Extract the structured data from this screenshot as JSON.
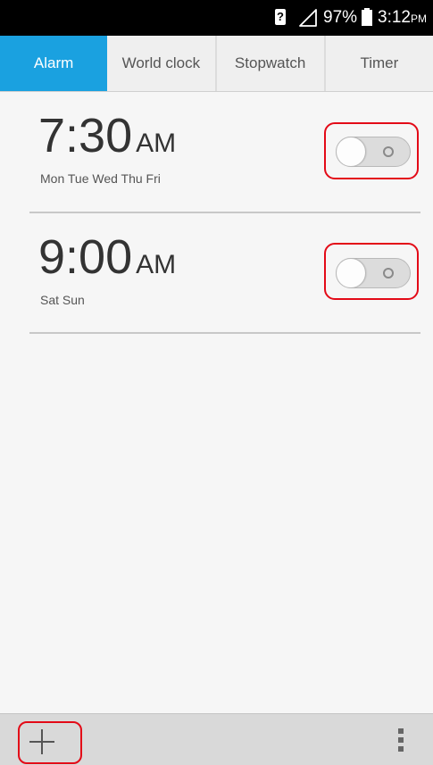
{
  "status_bar": {
    "sim_label": "?",
    "battery_percent": "97%",
    "time": "3:12",
    "time_suffix": "PM"
  },
  "tabs": [
    {
      "label": "Alarm",
      "active": true
    },
    {
      "label": "World clock",
      "active": false
    },
    {
      "label": "Stopwatch",
      "active": false
    },
    {
      "label": "Timer",
      "active": false
    }
  ],
  "alarms": [
    {
      "time": "7:30",
      "ampm": "AM",
      "days": "Mon Tue Wed Thu Fri",
      "enabled": false
    },
    {
      "time": "9:00",
      "ampm": "AM",
      "days": "Sat Sun",
      "enabled": false
    }
  ],
  "colors": {
    "accent": "#1aa1e0",
    "highlight_outline": "#e30a17"
  },
  "icons": {
    "add": "plus-icon",
    "menu": "overflow-menu-icon"
  }
}
